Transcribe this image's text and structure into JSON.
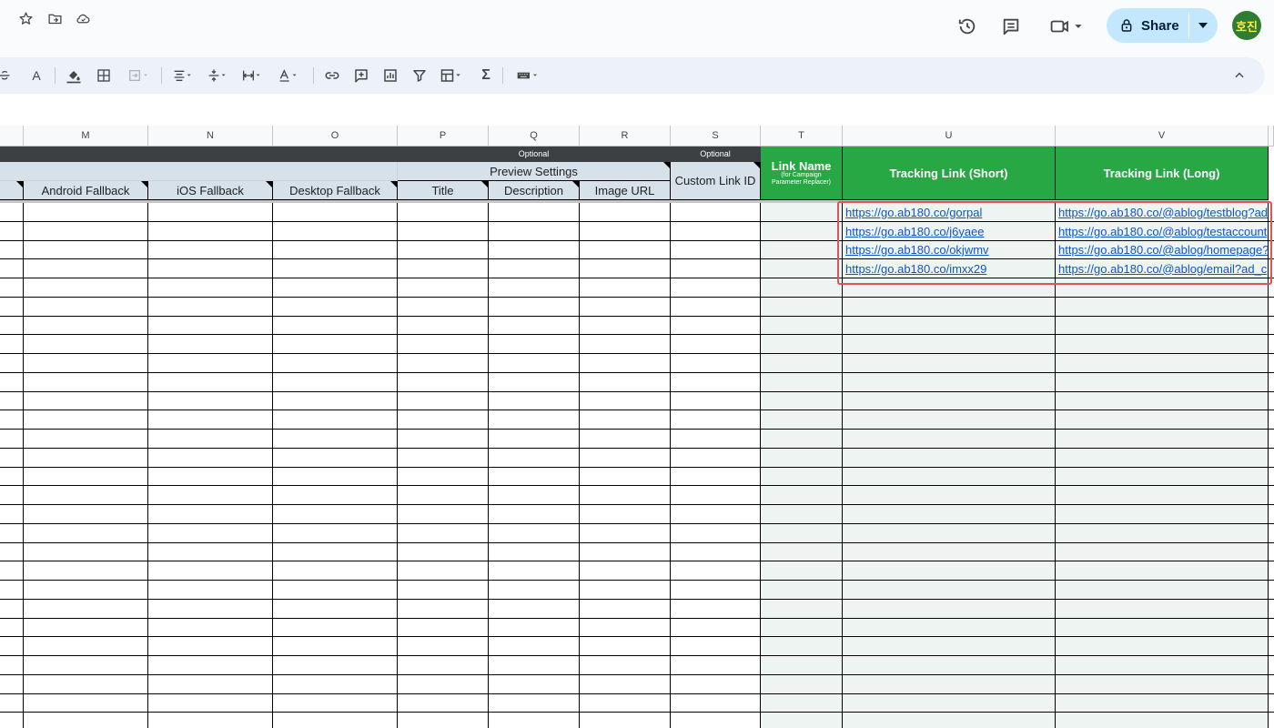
{
  "header": {
    "share_label": "Share",
    "avatar_text": "호진",
    "icons": [
      "star-icon",
      "move-to-folder-icon",
      "cloud-saved-icon",
      "history-icon",
      "comments-icon",
      "meet-video-icon",
      "lock-icon"
    ]
  },
  "toolbar": {
    "font_color_label": "A",
    "sum_label": "Σ",
    "items": [
      "strikethrough",
      "text-color",
      "fill-color",
      "borders",
      "merge-cells",
      "horizontal-align",
      "vertical-align",
      "text-wrapping",
      "text-rotation",
      "insert-link",
      "insert-comment",
      "insert-chart",
      "create-filter",
      "filter-views",
      "functions",
      "input-tools",
      "collapse-toolbar"
    ]
  },
  "sheet": {
    "columns": [
      "M",
      "N",
      "O",
      "P",
      "Q",
      "R",
      "S",
      "T",
      "U",
      "V"
    ],
    "optional_labels": {
      "preview": "Optional",
      "custom_link": "Optional"
    },
    "group_headers": {
      "preview_settings": "Preview Settings",
      "custom_link_id": "Custom Link ID"
    },
    "sub_headers": [
      "Android Fallback",
      "iOS Fallback",
      "Desktop Fallback",
      "Title",
      "Description",
      "Image URL"
    ],
    "link_name": {
      "title": "Link Name",
      "subtitle_1": "(for Campaign",
      "subtitle_2": "Parameter Replacer)"
    },
    "tracking_short": "Tracking Link (Short)",
    "tracking_long": "Tracking Link (Long)",
    "rows": [
      {
        "short": "https://go.ab180.co/gorpal",
        "long": "https://go.ab180.co/@ablog/testblog?ad"
      },
      {
        "short": "https://go.ab180.co/j6yaee",
        "long": "https://go.ab180.co/@ablog/testaccount"
      },
      {
        "short": "https://go.ab180.co/okjwmv",
        "long": "https://go.ab180.co/@ablog/homepage?"
      },
      {
        "short": "https://go.ab180.co/imxx29",
        "long": "https://go.ab180.co/@ablog/email?ad_c"
      }
    ]
  },
  "colors": {
    "header_green": "#27a844",
    "highlight_box": "#e35353",
    "link": "#1155cc"
  }
}
